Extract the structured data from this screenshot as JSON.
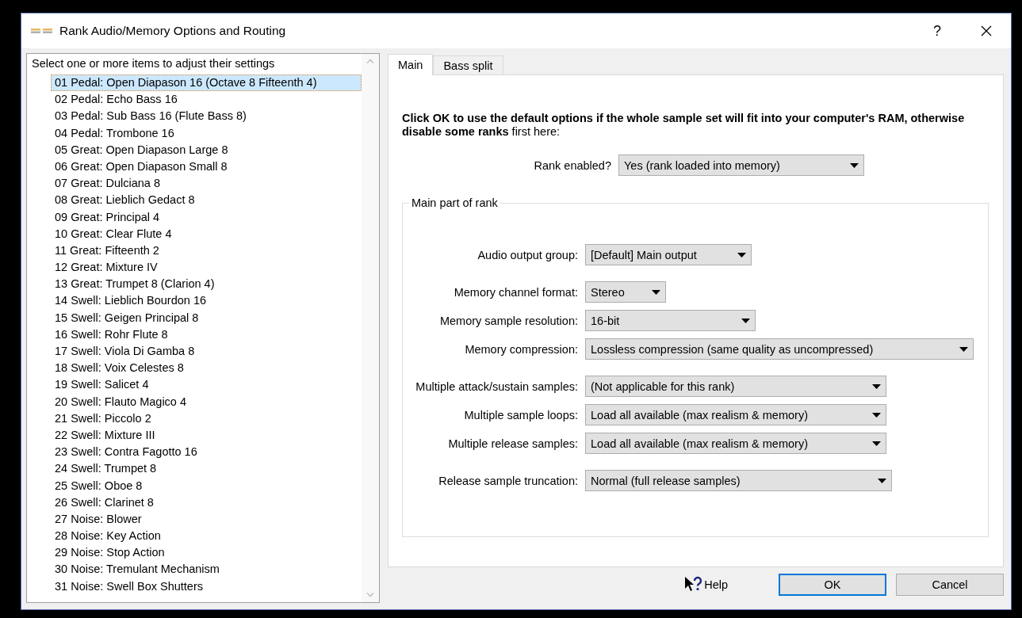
{
  "window": {
    "title": "Rank Audio/Memory Options and Routing",
    "help_glyph": "?"
  },
  "rank_list": {
    "header": "Select one or more items to adjust their settings",
    "items": [
      {
        "label": "01 Pedal: Open Diapason 16 (Octave 8 Fifteenth 4)",
        "selected": true
      },
      {
        "label": "02 Pedal: Echo Bass 16",
        "selected": false
      },
      {
        "label": "03 Pedal: Sub Bass 16 (Flute Bass 8)",
        "selected": false
      },
      {
        "label": "04 Pedal: Trombone 16",
        "selected": false
      },
      {
        "label": "05 Great: Open Diapason Large 8",
        "selected": false
      },
      {
        "label": "06 Great: Open Diapason Small 8",
        "selected": false
      },
      {
        "label": "07 Great: Dulciana 8",
        "selected": false
      },
      {
        "label": "08 Great: Lieblich Gedact 8",
        "selected": false
      },
      {
        "label": "09 Great: Principal 4",
        "selected": false
      },
      {
        "label": "10 Great: Clear Flute 4",
        "selected": false
      },
      {
        "label": "11 Great: Fifteenth 2",
        "selected": false
      },
      {
        "label": "12 Great: Mixture IV",
        "selected": false
      },
      {
        "label": "13 Great: Trumpet 8 (Clarion 4)",
        "selected": false
      },
      {
        "label": "14 Swell: Lieblich Bourdon 16",
        "selected": false
      },
      {
        "label": "15 Swell: Geigen Principal 8",
        "selected": false
      },
      {
        "label": "16 Swell: Rohr Flute 8",
        "selected": false
      },
      {
        "label": "17 Swell: Viola Di Gamba 8",
        "selected": false
      },
      {
        "label": "18 Swell: Voix Celestes 8",
        "selected": false
      },
      {
        "label": "19 Swell: Salicet 4",
        "selected": false
      },
      {
        "label": "20 Swell: Flauto Magico 4",
        "selected": false
      },
      {
        "label": "21 Swell: Piccolo 2",
        "selected": false
      },
      {
        "label": "22 Swell: Mixture III",
        "selected": false
      },
      {
        "label": "23 Swell: Contra Fagotto 16",
        "selected": false
      },
      {
        "label": "24 Swell: Trumpet 8",
        "selected": false
      },
      {
        "label": "25 Swell: Oboe 8",
        "selected": false
      },
      {
        "label": "26 Swell: Clarinet 8",
        "selected": false
      },
      {
        "label": "27 Noise: Blower",
        "selected": false
      },
      {
        "label": "28 Noise: Key Action",
        "selected": false
      },
      {
        "label": "29 Noise: Stop Action",
        "selected": false
      },
      {
        "label": "30 Noise: Tremulant Mechanism",
        "selected": false
      },
      {
        "label": "31 Noise: Swell Box Shutters",
        "selected": false
      }
    ]
  },
  "tabs": [
    {
      "label": "Main",
      "selected": true
    },
    {
      "label": "Bass split",
      "selected": false
    }
  ],
  "intro": "**Click OK to use the default options if the whole sample set will fit into your computer's RAM, otherwise disable some ranks** first here:",
  "rank_enabled": {
    "label": "Rank enabled?",
    "value": "Yes (rank loaded into memory)"
  },
  "group": {
    "title": "Main part of rank",
    "sections": [
      [
        {
          "label": "Audio output group:",
          "value": "[Default] Main output"
        }
      ],
      [
        {
          "label": "Memory channel format:",
          "value": "Stereo"
        },
        {
          "label": "Memory sample resolution:",
          "value": "16-bit"
        },
        {
          "label": "Memory compression:",
          "value": "Lossless compression (same quality as uncompressed)"
        }
      ],
      [
        {
          "label": "Multiple attack/sustain samples:",
          "value": "(Not applicable for this rank)"
        },
        {
          "label": "Multiple sample loops:",
          "value": "Load all available (max realism & memory)"
        },
        {
          "label": "Multiple release samples:",
          "value": "Load all available (max realism & memory)"
        }
      ],
      [
        {
          "label": "Release sample truncation:",
          "value": "Normal (full release samples)"
        }
      ]
    ]
  },
  "buttons": {
    "help": "Help",
    "ok": "OK",
    "cancel": "Cancel"
  }
}
